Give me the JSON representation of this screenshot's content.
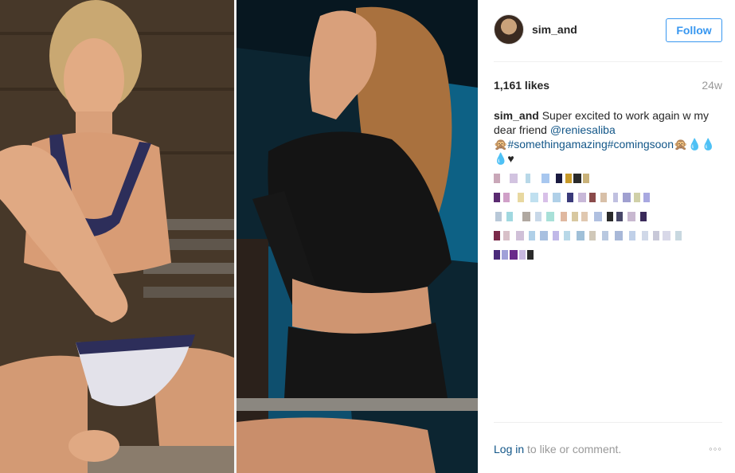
{
  "post": {
    "username": "sim_and",
    "follow_label": "Follow",
    "likes": "1,161 likes",
    "age": "24w",
    "caption_user": "sim_and",
    "caption_text_before": " Super excited to work again w my dear friend ",
    "caption_mention": "@reniesaliba",
    "caption_line2": "🙊",
    "caption_hashtags": "#somethingamazing#comingsoon",
    "caption_emoji_after": "🙊💧💧💧♥",
    "login_link": "Log in",
    "login_rest": " to like or comment.",
    "more_label": "◦◦◦"
  },
  "photos": [
    {
      "name": "left-photo",
      "subject": "woman in blue and white bikini seated on wooden bench"
    },
    {
      "name": "right-photo",
      "subject": "woman in black crop top by pool"
    }
  ],
  "comments_note": "pixelated-blurred",
  "colors": {
    "follow_blue": "#3897f0",
    "link_blue": "#125688",
    "muted": "#999999",
    "text": "#262626"
  }
}
